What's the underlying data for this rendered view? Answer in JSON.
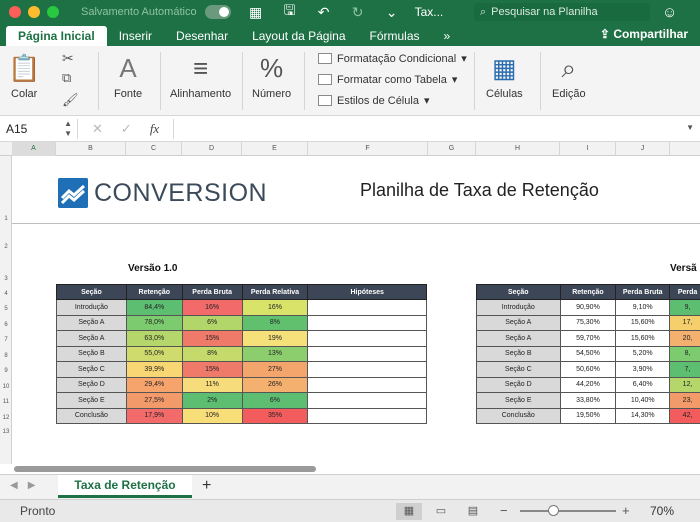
{
  "titlebar": {
    "autosave_label": "Salvamento Automático",
    "file_name": "Tax...",
    "search_placeholder": "Pesquisar na Planilha"
  },
  "ribbon_tabs": [
    "Página Inicial",
    "Inserir",
    "Desenhar",
    "Layout da Página",
    "Fórmulas",
    "»"
  ],
  "share_label": "Compartilhar",
  "ribbon": {
    "paste": "Colar",
    "font": "Fonte",
    "alignment": "Alinhamento",
    "number": "Número",
    "conditional_formatting": "Formatação Condicional",
    "format_table": "Formatar como Tabela",
    "cell_styles": "Estilos de Célula",
    "cells": "Células",
    "editing": "Edição"
  },
  "formula_bar": {
    "name_box": "A15",
    "formula": ""
  },
  "columns": [
    "A",
    "B",
    "C",
    "D",
    "E",
    "F",
    "G",
    "H",
    "I",
    "J"
  ],
  "rows": [
    "1",
    "2",
    "3",
    "4",
    "5",
    "6",
    "7",
    "8",
    "9",
    "10",
    "11",
    "12",
    "13"
  ],
  "sheet": {
    "logo_text": "CONVERSION",
    "title": "Planilha de Taxa de Retenção",
    "version1_label": "Versão 1.0",
    "version2_label": "Versã",
    "table1": {
      "headers": [
        "Seção",
        "Retenção",
        "Perda Bruta",
        "Perda Relativa",
        "Hipóteses"
      ],
      "rows": [
        [
          "Introdução",
          "84,4%",
          "16%",
          "16%",
          ""
        ],
        [
          "Seção A",
          "78,0%",
          "6%",
          "8%",
          ""
        ],
        [
          "Seção A",
          "63,0%",
          "15%",
          "19%",
          ""
        ],
        [
          "Seção B",
          "55,0%",
          "8%",
          "13%",
          ""
        ],
        [
          "Seção C",
          "39,9%",
          "15%",
          "27%",
          ""
        ],
        [
          "Seção D",
          "29,4%",
          "11%",
          "26%",
          ""
        ],
        [
          "Seção E",
          "27,5%",
          "2%",
          "6%",
          ""
        ],
        [
          "Conclusão",
          "17,9%",
          "10%",
          "35%",
          ""
        ]
      ],
      "colors": [
        [
          "#d9d9d9",
          "#5dbe72",
          "#f26a6a",
          "#d9e36a",
          "#ffffff"
        ],
        [
          "#d9d9d9",
          "#7ccb6e",
          "#b3d66a",
          "#61c06e",
          "#ffffff"
        ],
        [
          "#d9d9d9",
          "#b5d66b",
          "#f07a6a",
          "#f6e07a",
          "#ffffff"
        ],
        [
          "#d9d9d9",
          "#cfdc6d",
          "#c6da6c",
          "#8ccd6e",
          "#ffffff"
        ],
        [
          "#d9d9d9",
          "#f8d674",
          "#f07a6a",
          "#f4a56c",
          "#ffffff"
        ],
        [
          "#d9d9d9",
          "#f6a46c",
          "#f6dc7a",
          "#f4b06e",
          "#ffffff"
        ],
        [
          "#d9d9d9",
          "#f39a6b",
          "#5dbe72",
          "#5dbe72",
          "#ffffff"
        ],
        [
          "#d9d9d9",
          "#f26a6a",
          "#f8de78",
          "#f25c5c",
          "#ffffff"
        ]
      ]
    },
    "table2": {
      "headers": [
        "Seção",
        "Retenção",
        "Perda Bruta",
        "Perda"
      ],
      "rows": [
        [
          "Introdução",
          "90,90%",
          "9,10%",
          "9,"
        ],
        [
          "Seção A",
          "75,30%",
          "15,60%",
          "17,"
        ],
        [
          "Seção A",
          "59,70%",
          "15,60%",
          "20,"
        ],
        [
          "Seção B",
          "54,50%",
          "5,20%",
          "8,"
        ],
        [
          "Seção C",
          "50,60%",
          "3,90%",
          "7,"
        ],
        [
          "Seção D",
          "44,20%",
          "6,40%",
          "12,"
        ],
        [
          "Seção E",
          "33,80%",
          "10,40%",
          "23,"
        ],
        [
          "Conclusão",
          "19,50%",
          "14,30%",
          "42,"
        ]
      ],
      "colors": [
        [
          "#d9d9d9",
          "#ffffff",
          "#ffffff",
          "#5dbe72"
        ],
        [
          "#d9d9d9",
          "#ffffff",
          "#ffffff",
          "#f4cf6c"
        ],
        [
          "#d9d9d9",
          "#ffffff",
          "#ffffff",
          "#f4b06e"
        ],
        [
          "#d9d9d9",
          "#ffffff",
          "#ffffff",
          "#7ccb6e"
        ],
        [
          "#d9d9d9",
          "#ffffff",
          "#ffffff",
          "#5dbe72"
        ],
        [
          "#d9d9d9",
          "#ffffff",
          "#ffffff",
          "#b5d66b"
        ],
        [
          "#d9d9d9",
          "#ffffff",
          "#ffffff",
          "#f39a6b"
        ],
        [
          "#d9d9d9",
          "#ffffff",
          "#ffffff",
          "#f25c5c"
        ]
      ]
    }
  },
  "sheet_tabs": [
    "Taxa de Retenção"
  ],
  "status": {
    "ready": "Pronto",
    "zoom": "70%"
  }
}
